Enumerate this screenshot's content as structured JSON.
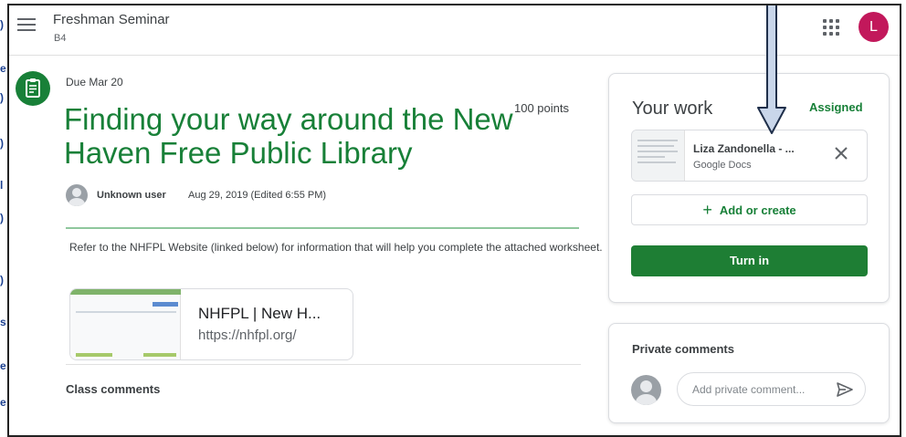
{
  "topbar": {
    "class_name": "Freshman Seminar",
    "section": "B4",
    "account_initial": "L",
    "account_color": "#c2185b"
  },
  "assignment": {
    "due": "Due Mar 20",
    "points": "100 points",
    "title": "Finding your way around the New Haven Free Public Library",
    "author": "Unknown user",
    "date": "Aug 29, 2019 (Edited 6:55 PM)",
    "description": "Refer to the NHFPL Website (linked below) for information that will help you complete the attached worksheet.",
    "link": {
      "title": "NHFPL | New H...",
      "url": "https://nhfpl.org/"
    },
    "class_comments_label": "Class comments"
  },
  "your_work": {
    "title": "Your work",
    "status": "Assigned",
    "file": {
      "name": "Liza Zandonella - ...",
      "type": "Google Docs"
    },
    "add_label": "Add or create",
    "turn_in_label": "Turn in"
  },
  "private_comments": {
    "title": "Private comments",
    "placeholder": "Add private comment..."
  },
  "colors": {
    "accent_green": "#188038",
    "button_green": "#1e7e34"
  },
  "icons": {
    "menu": "hamburger-menu-icon",
    "apps": "apps-grid-icon",
    "assignment": "assignment-icon",
    "close": "close-icon",
    "add": "plus-icon",
    "send": "send-icon",
    "annotation": "down-arrow-annotation"
  }
}
